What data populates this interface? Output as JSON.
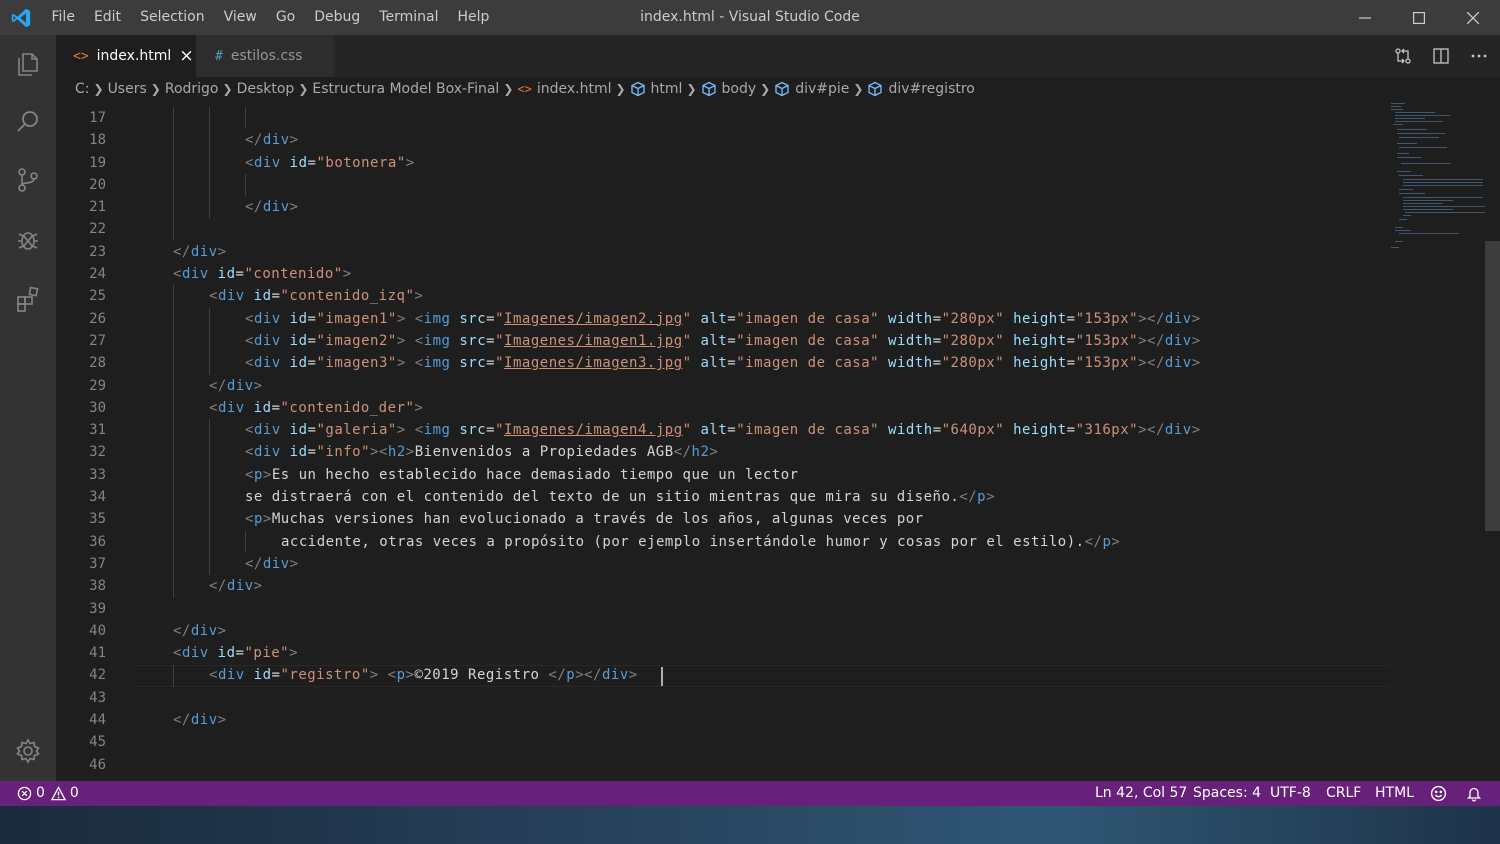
{
  "titlebar": {
    "menu": [
      "File",
      "Edit",
      "Selection",
      "View",
      "Go",
      "Debug",
      "Terminal",
      "Help"
    ],
    "window_title": "index.html - Visual Studio Code",
    "logo_color": "#23a9f2"
  },
  "activity_icons": [
    "explorer-icon",
    "search-icon",
    "source-control-icon",
    "debug-icon",
    "extensions-icon",
    "settings-gear-icon"
  ],
  "tabs": [
    {
      "label": "index.html",
      "icon": "<>",
      "active": true,
      "close": "×",
      "icon_color": "#e37933"
    },
    {
      "label": "estilos.css",
      "icon": "#",
      "active": false,
      "icon_color": "#519aba"
    }
  ],
  "breadcrumb": [
    "C:",
    "Users",
    "Rodrigo",
    "Desktop",
    "Estructura Model Box-Final",
    "index.html",
    "html",
    "body",
    "div#pie",
    "div#registro"
  ],
  "line_numbers": [
    "17",
    "18",
    "19",
    "20",
    "21",
    "22",
    "23",
    "24",
    "25",
    "26",
    "27",
    "28",
    "29",
    "30",
    "31",
    "32",
    "33",
    "34",
    "35",
    "36",
    "37",
    "38",
    "39",
    "40",
    "41",
    "42",
    "43",
    "44",
    "45",
    "46"
  ],
  "code_lines": [
    "",
    "</div>",
    "<div id=\"botonera\">",
    "",
    "</div>",
    "",
    "</div>",
    "<div id=\"contenido\">",
    "<div id=\"contenido_izq\">",
    "<div id=\"imagen1\"> <img src=\"Imagenes/imagen2.jpg\" alt=\"imagen de casa\" width=\"280px\" height=\"153px\"></div>",
    "<div id=\"imagen2\"> <img src=\"Imagenes/imagen1.jpg\" alt=\"imagen de casa\" width=\"280px\" height=\"153px\"></div>",
    "<div id=\"imagen3\"> <img src=\"Imagenes/imagen3.jpg\" alt=\"imagen de casa\" width=\"280px\" height=\"153px\"></div>",
    "</div>",
    "<div id=\"contenido_der\">",
    "<div id=\"galeria\"> <img src=\"Imagenes/imagen4.jpg\" alt=\"imagen de casa\" width=\"640px\" height=\"316px\"></div>",
    "<div id=\"info\"><h2>Bienvenidos a Propiedades AGB</h2>",
    "<p>Es un hecho establecido hace demasiado tiempo que un lector",
    "se distraerá con el contenido del texto de un sitio mientras que mira su diseño.</p>",
    "<p>Muchas versiones han evolucionado a través de los años, algunas veces por",
    "accidente, otras veces a propósito (por ejemplo insertándole humor y cosas por el estilo).</p>",
    "</div>",
    "</div>",
    "",
    "</div>",
    "<div id=\"pie\">",
    "<div id=\"registro\"> <p>©2019 Registro </p></div>",
    "",
    "</div>",
    "",
    ""
  ],
  "status": {
    "errors": "0",
    "warnings": "0",
    "position": "Ln 42, Col 57",
    "spaces": "Spaces: 4",
    "encoding": "UTF-8",
    "eol": "CRLF",
    "language": "HTML",
    "bar_color": "#68217a"
  }
}
